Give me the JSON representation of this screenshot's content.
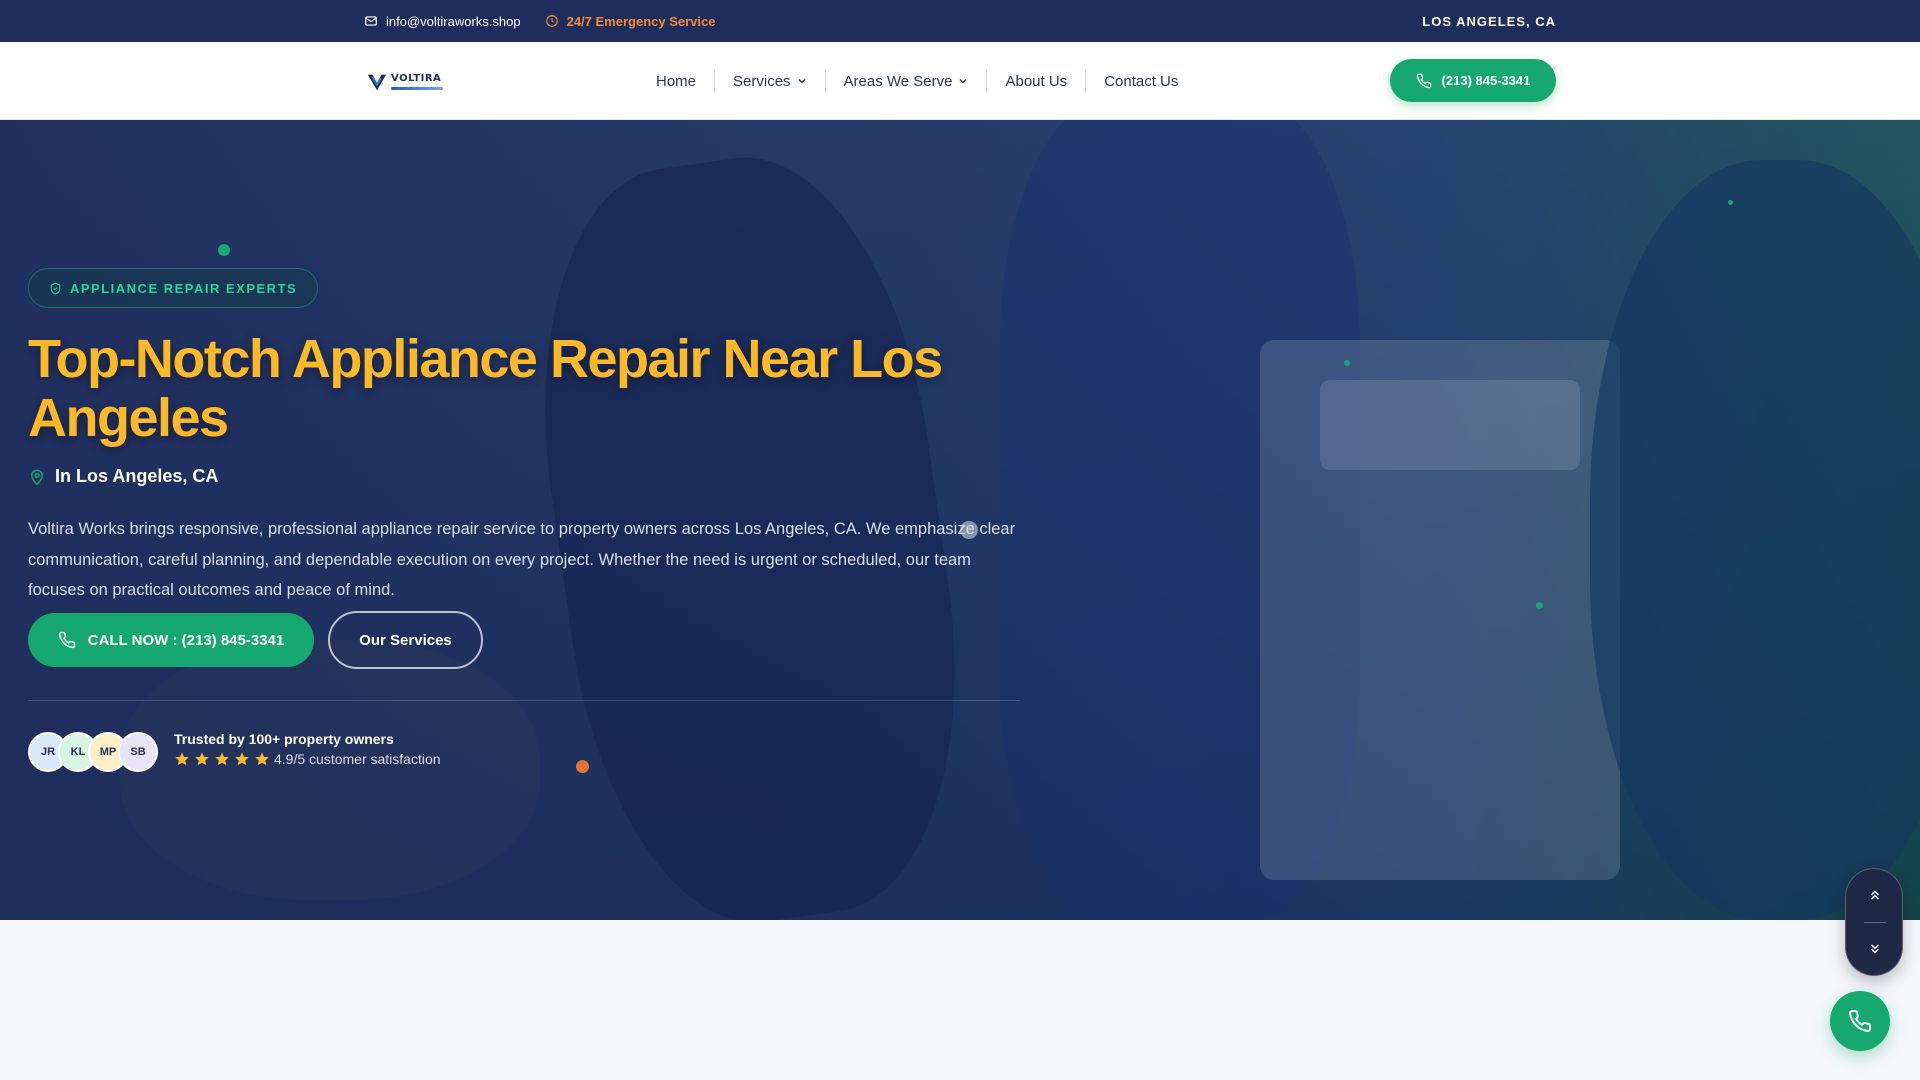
{
  "topbar": {
    "email": "info@voltiraworks.shop",
    "emergency": "24/7 Emergency Service",
    "location": "LOS ANGELES, CA"
  },
  "header": {
    "logo_text": "VOLTIRA",
    "nav": [
      {
        "label": "Home",
        "dropdown": false
      },
      {
        "label": "Services",
        "dropdown": true
      },
      {
        "label": "Areas We Serve",
        "dropdown": true
      },
      {
        "label": "About Us",
        "dropdown": false
      },
      {
        "label": "Contact Us",
        "dropdown": false
      }
    ],
    "call_label": "(213) 845-3341"
  },
  "hero": {
    "badge": "APPLIANCE REPAIR EXPERTS",
    "title": "Top-Notch Appliance Repair Near Los Angeles",
    "location": "In Los Angeles, CA",
    "description": "Voltira Works brings responsive, professional appliance repair service to property owners across Los Angeles, CA. We emphasize clear communication, careful planning, and dependable execution on every project. Whether the need is urgent or scheduled, our team focuses on practical outcomes and peace of mind.",
    "primary_button": "CALL NOW : (213) 845-3341",
    "secondary_button": "Our Services",
    "avatars": [
      {
        "initials": "JR",
        "color": "#dbe7fb"
      },
      {
        "initials": "KL",
        "color": "#d6f3e4"
      },
      {
        "initials": "MP",
        "color": "#fcefc7"
      },
      {
        "initials": "SB",
        "color": "#e8e3f6"
      }
    ],
    "trust_title": "Trusted by 100+ property owners",
    "rating_text": "4.9/5 customer satisfaction",
    "stars": 5
  },
  "icons": [
    "mail-icon",
    "clock-icon",
    "phone-icon",
    "shield-icon",
    "map-pin-icon",
    "chevron-down-icon",
    "star-icon",
    "double-chevron-up-icon",
    "double-chevron-down-icon"
  ],
  "colors": {
    "navy": "#1e2d5c",
    "green": "#15a86f",
    "gold": "#fbb928",
    "orange": "#f28b3b"
  }
}
